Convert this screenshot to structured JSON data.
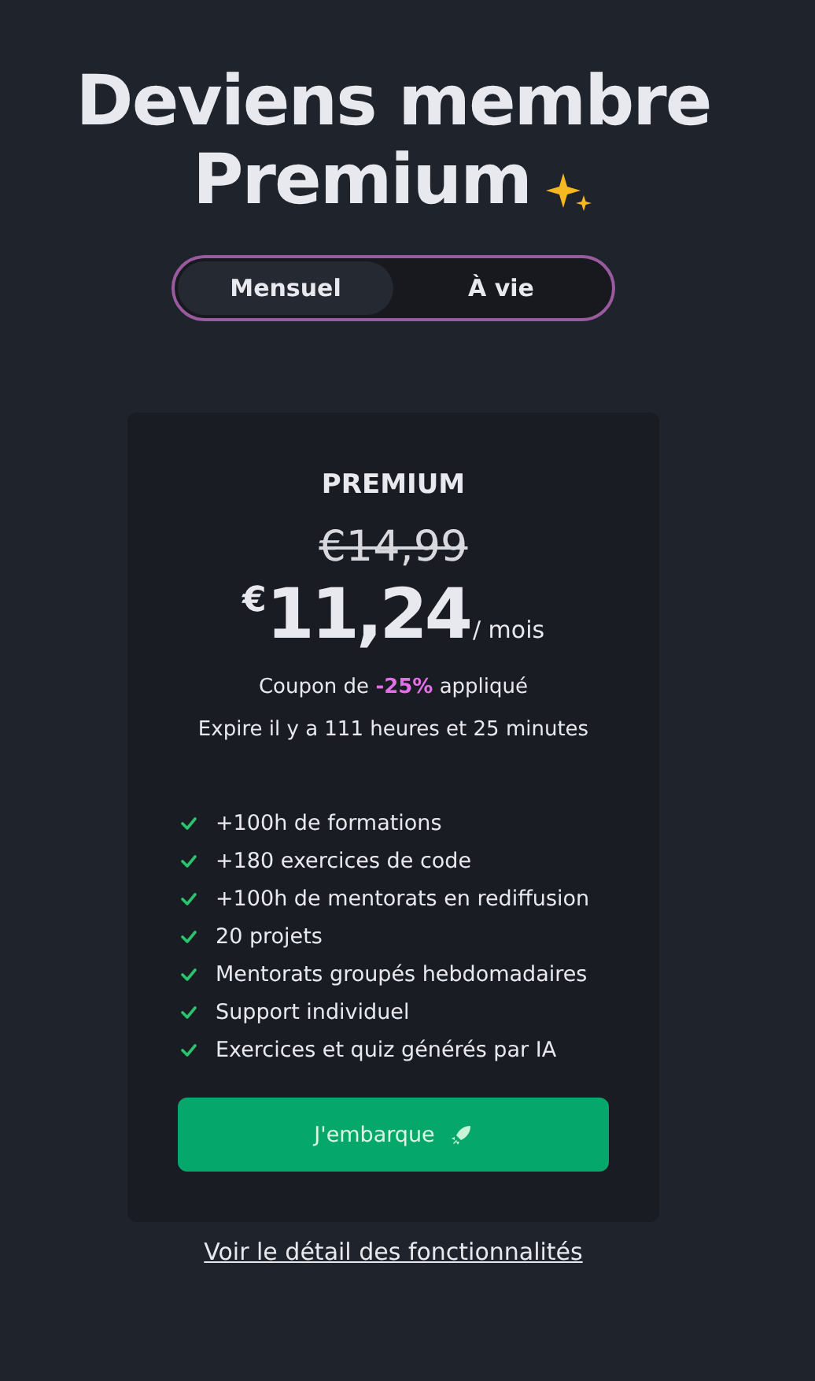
{
  "title": {
    "line1": "Deviens membre",
    "line2": "Premium"
  },
  "tabs": [
    {
      "label": "Mensuel",
      "selected": true
    },
    {
      "label": "À vie",
      "selected": false
    }
  ],
  "plan": {
    "name": "PREMIUM",
    "old_price": "€14,99",
    "currency": "€",
    "price": "11,24",
    "period": "/ mois",
    "coupon": "Coupon de **-25%** appliqué",
    "expiry": "Expire il y a 111 heures et 25 minutes",
    "features": [
      "+100h de formations",
      "+180 exercices de code",
      "+100h de mentorats en rediffusion",
      "20 projets",
      "Mentorats groupés hebdomadaires",
      "Support individuel",
      "Exercices et quiz générés par IA"
    ],
    "button": "J'embarque"
  },
  "details_link": "Voir le détail des fonctionnalités"
}
